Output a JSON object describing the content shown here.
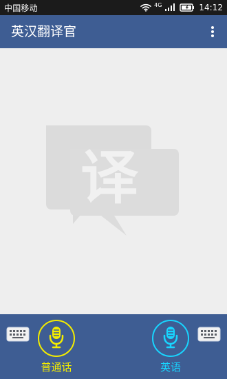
{
  "status_bar": {
    "carrier": "中国移动",
    "network_type": "4G",
    "time": "14:12",
    "icons": {
      "wifi": "wifi-icon",
      "signal": "signal-icon",
      "battery": "battery-icon"
    }
  },
  "app_bar": {
    "title": "英汉翻译官",
    "menu_icon": "more-vertical-icon",
    "background_color": "#3e5d93"
  },
  "content": {
    "watermark_icon": "translation-bubble-icon",
    "watermark_text": "译"
  },
  "bottom_bar": {
    "background_color": "#3e5d93",
    "left_keyboard_icon": "keyboard-icon",
    "right_keyboard_icon": "keyboard-icon",
    "mandarin": {
      "label": "普通话",
      "icon": "microphone-icon",
      "color": "#f3ec00"
    },
    "english": {
      "label": "英语",
      "icon": "microphone-icon",
      "color": "#18d5ff"
    }
  }
}
